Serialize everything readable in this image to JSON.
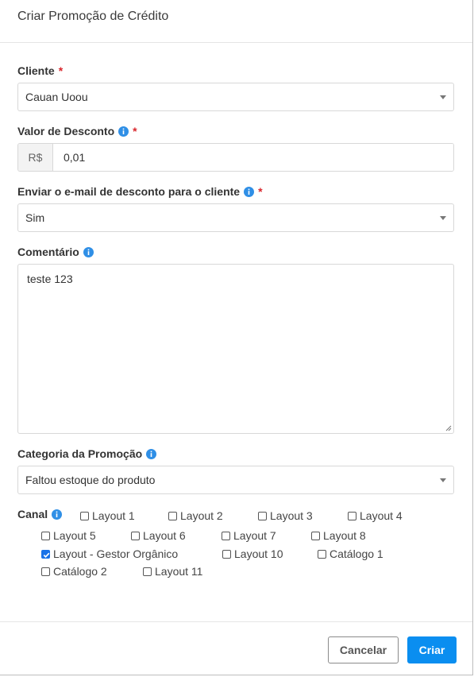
{
  "modal": {
    "title": "Criar Promoção de Crédito"
  },
  "fields": {
    "cliente": {
      "label": "Cliente",
      "required_mark": "*",
      "value": "Cauan Uoou"
    },
    "desconto": {
      "label": "Valor de Desconto",
      "required_mark": "*",
      "prefix": "R$",
      "value": "0,01"
    },
    "email": {
      "label": "Enviar o e-mail de desconto para o cliente",
      "required_mark": "*",
      "value": "Sim"
    },
    "comentario": {
      "label": "Comentário",
      "value": "teste 123"
    },
    "categoria": {
      "label": "Categoria da Promoção",
      "value": "Faltou estoque do produto"
    }
  },
  "canal": {
    "label": "Canal",
    "options": [
      {
        "label": "Layout 1",
        "checked": false
      },
      {
        "label": "Layout 2",
        "checked": false
      },
      {
        "label": "Layout 3",
        "checked": false
      },
      {
        "label": "Layout 4",
        "checked": false
      },
      {
        "label": "Layout 5",
        "checked": false
      },
      {
        "label": "Layout 6",
        "checked": false
      },
      {
        "label": "Layout 7",
        "checked": false
      },
      {
        "label": "Layout 8",
        "checked": false
      },
      {
        "label": "Layout - Gestor Orgânico",
        "checked": true
      },
      {
        "label": "Layout 10",
        "checked": false
      },
      {
        "label": "Catálogo 1",
        "checked": false
      },
      {
        "label": "Catálogo 2",
        "checked": false
      },
      {
        "label": "Layout 11",
        "checked": false
      }
    ]
  },
  "footer": {
    "cancel_label": "Cancelar",
    "create_label": "Criar"
  },
  "colors": {
    "primary": "#0a8ef0",
    "required": "#d9262c",
    "info_icon": "#2f8fe6",
    "checkbox_checked": "#1a73e8"
  }
}
